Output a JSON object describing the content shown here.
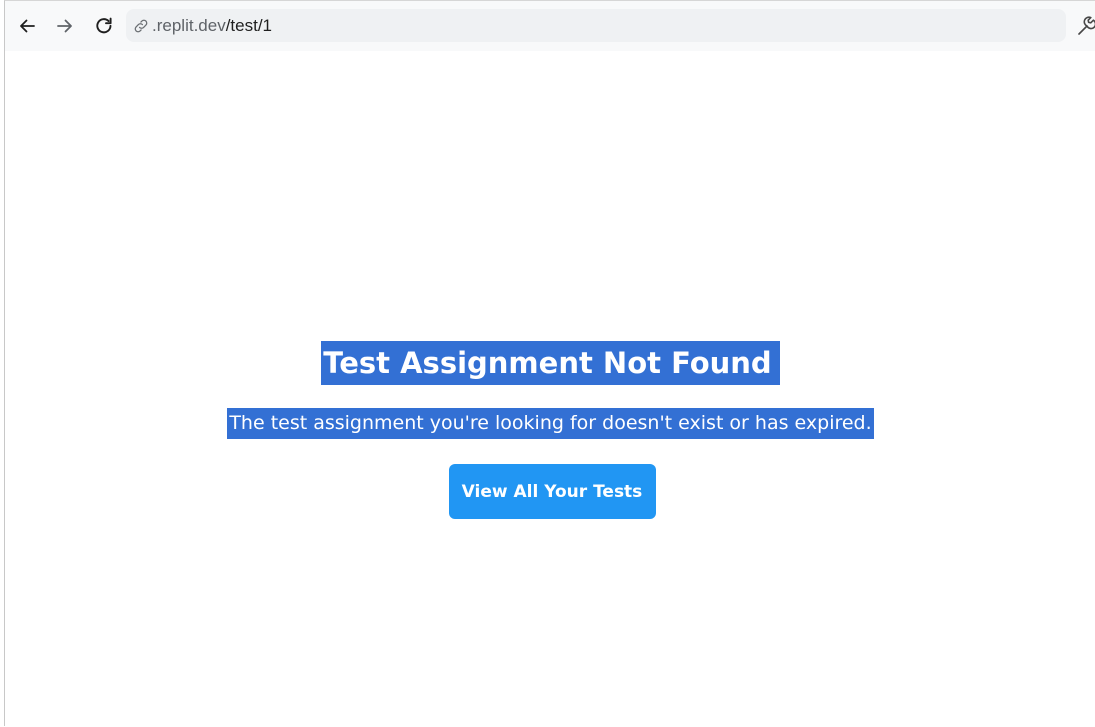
{
  "browser": {
    "url_host": ".replit.dev",
    "url_path": "/test/1",
    "icons": {
      "back": "arrow-left-icon",
      "forward": "arrow-right-icon",
      "reload": "reload-icon",
      "site_info": "link-icon",
      "extensions": "wrench-icon"
    }
  },
  "page": {
    "title": "Test Assignment Not Found",
    "message": "The test assignment you're looking for doesn't exist or has expired.",
    "button_label": "View All Your Tests"
  },
  "colors": {
    "selection_highlight": "#3370d4",
    "button_bg": "#2196f3",
    "toolbar_bg": "#f8f9fa",
    "omnibox_bg": "#eff1f3"
  }
}
